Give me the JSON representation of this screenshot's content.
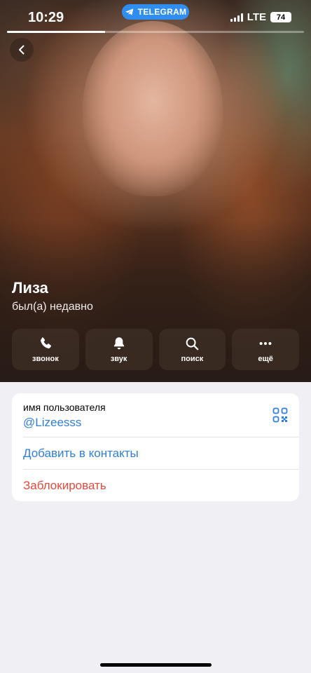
{
  "status_bar": {
    "time": "10:29",
    "app_pill": "TELEGRAM",
    "network": "LTE",
    "battery": "74"
  },
  "photo_progress": 0.33,
  "profile": {
    "name": "Лиза",
    "status": "был(а) недавно"
  },
  "actions": [
    {
      "label": "звонок",
      "icon": "phone-icon"
    },
    {
      "label": "звук",
      "icon": "bell-icon"
    },
    {
      "label": "поиск",
      "icon": "search-icon"
    },
    {
      "label": "ещё",
      "icon": "more-icon"
    }
  ],
  "info": {
    "username_caption": "имя пользователя",
    "username": "@Lizeesss",
    "add_contact": "Добавить в контакты",
    "block": "Заблокировать"
  },
  "colors": {
    "link": "#2f7fd8",
    "destructive": "#e4493c",
    "telegram": "#2f8ef0",
    "background": "#efeff4"
  }
}
